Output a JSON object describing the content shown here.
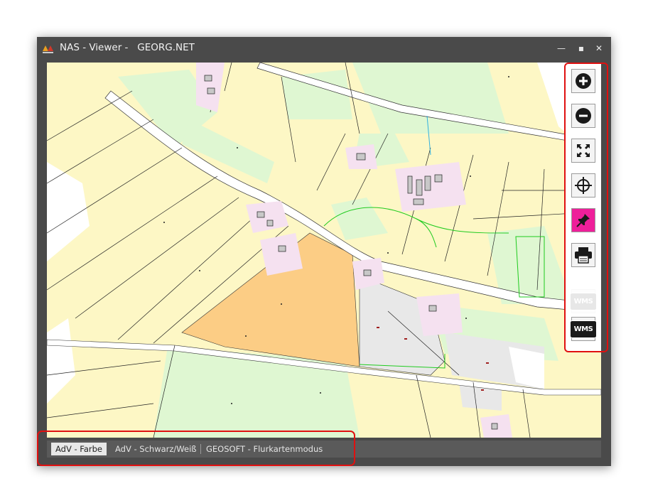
{
  "window": {
    "title": "NAS - Viewer -   GEORG.NET",
    "controls": {
      "minimize": "—",
      "maximize": "▪",
      "close": "✕"
    }
  },
  "toolbar": {
    "tools": [
      {
        "name": "zoom-in",
        "icon": "plus-circle-icon"
      },
      {
        "name": "zoom-out",
        "icon": "minus-circle-icon"
      },
      {
        "name": "zoom-extent",
        "icon": "expand-arrows-icon"
      },
      {
        "name": "center",
        "icon": "crosshair-icon"
      },
      {
        "name": "pin",
        "icon": "pushpin-icon",
        "active": true
      },
      {
        "name": "print",
        "icon": "printer-icon"
      },
      {
        "name": "wms-disabled",
        "label": "WMS",
        "disabled": true
      },
      {
        "name": "wms",
        "label": "WMS"
      }
    ],
    "active_color": "#ee1f9a"
  },
  "status_tabs": [
    {
      "label": "AdV - Farbe",
      "active": true
    },
    {
      "label": "AdV - Schwarz/Weiß",
      "active": false
    },
    {
      "label": "GEOSOFT - Flurkartenmodus",
      "active": false
    }
  ],
  "map_colors": {
    "parcel": "#fdf7c5",
    "green": "#dff7d2",
    "orange": "#fccd85",
    "grey": "#e8e8e8",
    "building": "#f5e1f0",
    "road": "#ffffff",
    "highlight": "#e01010"
  }
}
